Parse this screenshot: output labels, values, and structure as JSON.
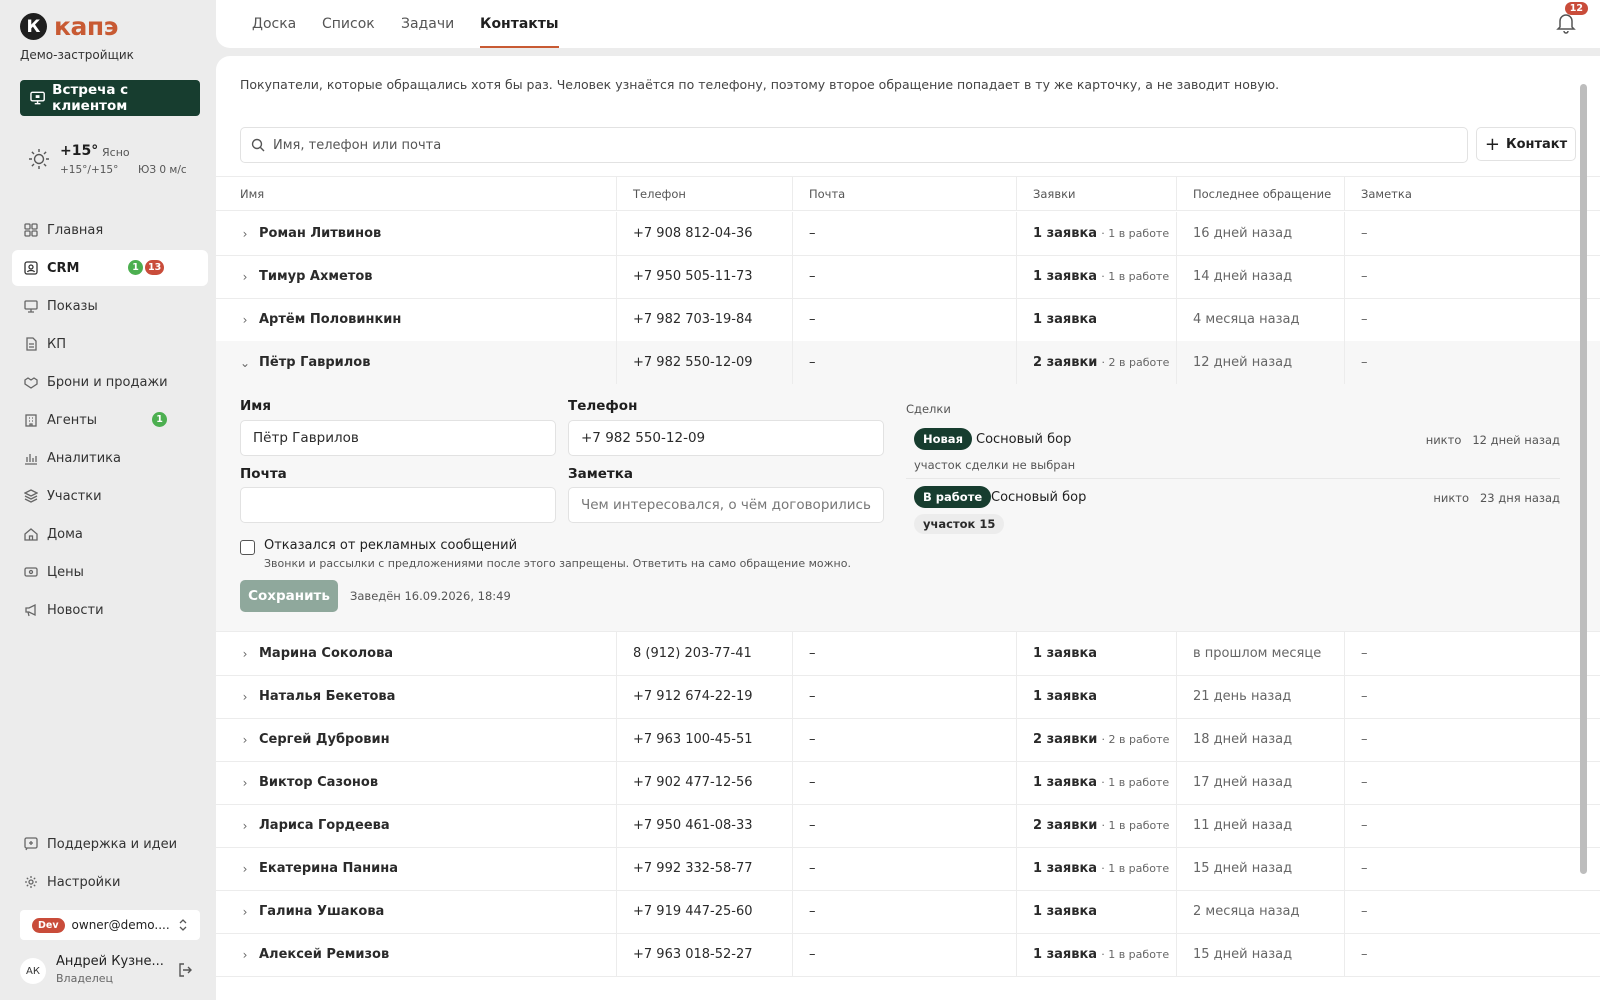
{
  "app": {
    "logo_mark": "К",
    "logo_text": "капэ",
    "company": "Демо-застройщик",
    "meet_button": "Встреча с клиентом"
  },
  "weather": {
    "temp": "+15°",
    "condition": "Ясно",
    "range": "+15°/+15°",
    "wind": "ЮЗ 0 м/с"
  },
  "sidebar": {
    "items": [
      {
        "label": "Главная",
        "icon": "grid-icon"
      },
      {
        "label": "CRM",
        "icon": "crm-icon",
        "badge_green": "1",
        "badge_red": "13",
        "active": true
      },
      {
        "label": "Показы",
        "icon": "monitor-icon"
      },
      {
        "label": "КП",
        "icon": "document-icon"
      },
      {
        "label": "Брони и продажи",
        "icon": "handshake-icon"
      },
      {
        "label": "Агенты",
        "icon": "building-icon",
        "badge_green": "1"
      },
      {
        "label": "Аналитика",
        "icon": "chart-icon"
      },
      {
        "label": "Участки",
        "icon": "layers-icon"
      },
      {
        "label": "Дома",
        "icon": "home-icon"
      },
      {
        "label": "Цены",
        "icon": "price-icon"
      },
      {
        "label": "Новости",
        "icon": "megaphone-icon"
      }
    ],
    "support": "Поддержка и идеи",
    "settings": "Настройки",
    "env_tag": "Dev",
    "account_email": "owner@demo....",
    "user_initials": "АК",
    "user_name": "Андрей Кузне...",
    "user_role": "Владелец"
  },
  "tabs": [
    "Доска",
    "Список",
    "Задачи",
    "Контакты"
  ],
  "active_tab": "Контакты",
  "notifications": "12",
  "main": {
    "description": "Покупатели, которые обращались хотя бы раз. Человек узнаётся по телефону, поэтому второе обращение попадает в ту же карточку, а не заводит новую.",
    "search_placeholder": "Имя, телефон или почта",
    "add_contact": "Контакт"
  },
  "table": {
    "headers": [
      "Имя",
      "Телефон",
      "Почта",
      "Заявки",
      "Последнее обращение",
      "Заметка"
    ],
    "rows": [
      {
        "name": "Роман Литвинов",
        "phone": "+7 908 812-04-36",
        "email": "–",
        "req": "1 заявка",
        "req_extra": "· 1 в работе",
        "last": "16 дней назад",
        "note": "–"
      },
      {
        "name": "Тимур Ахметов",
        "phone": "+7 950 505-11-73",
        "email": "–",
        "req": "1 заявка",
        "req_extra": "· 1 в работе",
        "last": "14 дней назад",
        "note": "–"
      },
      {
        "name": "Артём Половинкин",
        "phone": "+7 982 703-19-84",
        "email": "–",
        "req": "1 заявка",
        "req_extra": "",
        "last": "4 месяца назад",
        "note": "–"
      },
      {
        "name": "Пётр Гаврилов",
        "phone": "+7 982 550-12-09",
        "email": "–",
        "req": "2 заявки",
        "req_extra": "· 2 в работе",
        "last": "12 дней назад",
        "note": "–"
      },
      {
        "name": "Марина Соколова",
        "phone": "8 (912) 203-77-41",
        "email": "–",
        "req": "1 заявка",
        "req_extra": "",
        "last": "в прошлом месяце",
        "note": "–"
      },
      {
        "name": "Наталья Бекетова",
        "phone": "+7 912 674-22-19",
        "email": "–",
        "req": "1 заявка",
        "req_extra": "",
        "last": "21 день назад",
        "note": "–"
      },
      {
        "name": "Сергей Дубровин",
        "phone": "+7 963 100-45-51",
        "email": "–",
        "req": "2 заявки",
        "req_extra": "· 2 в работе",
        "last": "18 дней назад",
        "note": "–"
      },
      {
        "name": "Виктор Сазонов",
        "phone": "+7 902 477-12-56",
        "email": "–",
        "req": "1 заявка",
        "req_extra": "· 1 в работе",
        "last": "17 дней назад",
        "note": "–"
      },
      {
        "name": "Лариса Гордеева",
        "phone": "+7 950 461-08-33",
        "email": "–",
        "req": "2 заявки",
        "req_extra": "· 1 в работе",
        "last": "11 дней назад",
        "note": "–"
      },
      {
        "name": "Екатерина Панина",
        "phone": "+7 992 332-58-77",
        "email": "–",
        "req": "1 заявка",
        "req_extra": "· 1 в работе",
        "last": "15 дней назад",
        "note": "–"
      },
      {
        "name": "Галина Ушакова",
        "phone": "+7 919 447-25-60",
        "email": "–",
        "req": "1 заявка",
        "req_extra": "",
        "last": "2 месяца назад",
        "note": "–"
      },
      {
        "name": "Алексей Ремизов",
        "phone": "+7 963 018-52-27",
        "email": "–",
        "req": "1 заявка",
        "req_extra": "· 1 в работе",
        "last": "15 дней назад",
        "note": "–"
      }
    ]
  },
  "detail": {
    "name_label": "Имя",
    "name_value": "Пётр Гаврилов",
    "phone_label": "Телефон",
    "phone_value": "+7 982 550-12-09",
    "email_label": "Почта",
    "email_value": "",
    "note_label": "Заметка",
    "note_placeholder": "Чем интересовался, о чём договорились",
    "optout_label": "Отказался от рекламных сообщений",
    "optout_hint": "Звонки и рассылки с предложениями после этого запрещены. Ответить на само обращение можно.",
    "save": "Сохранить",
    "created": "Заведён 16.09.2026, 18:49",
    "deals_title": "Сделки",
    "deals": [
      {
        "status": "Новая",
        "name": "Сосновый бор",
        "sub": "участок сделки не выбран",
        "who": "никто",
        "when": "12 дней назад"
      },
      {
        "status": "В работе",
        "name": "Сосновый бор",
        "plot": "участок 15",
        "who": "никто",
        "when": "23 дня назад"
      }
    ]
  }
}
